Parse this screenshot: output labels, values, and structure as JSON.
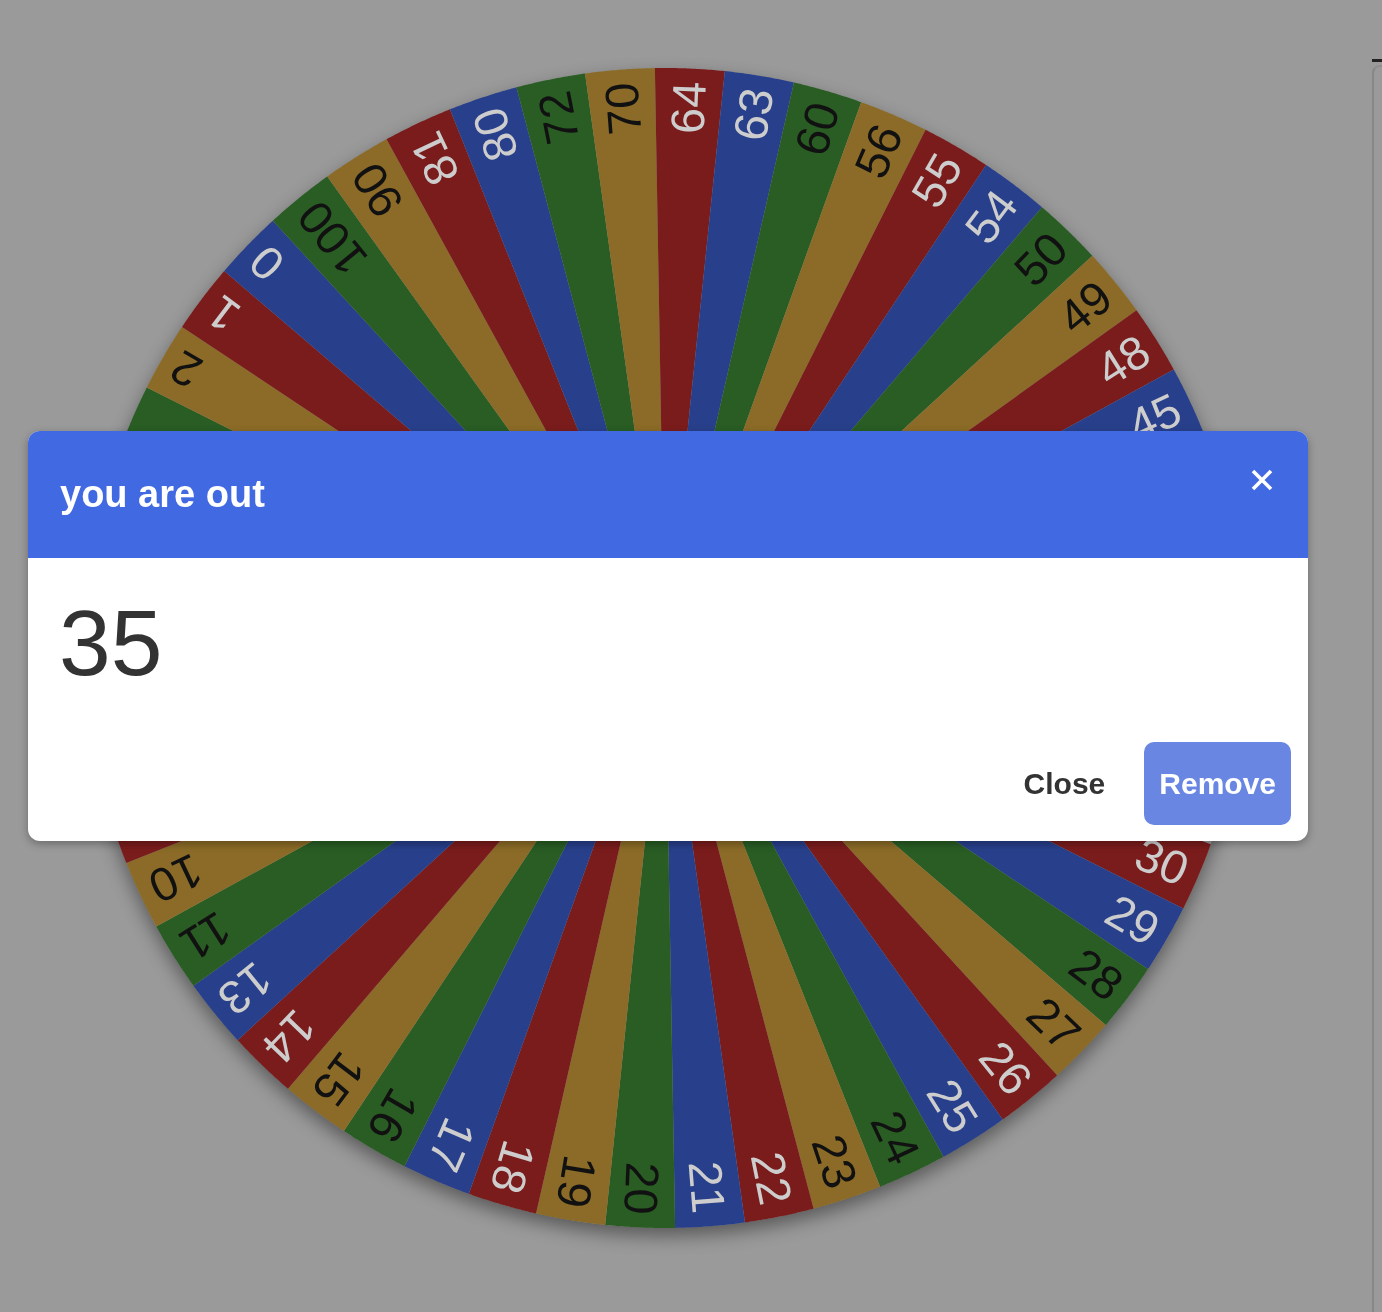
{
  "wheel": {
    "upper_arc": [
      {
        "color": "#295d24"
      },
      {
        "label": "2",
        "color": "#8b6b27"
      },
      {
        "label": "1",
        "color": "#7b1c1c"
      },
      {
        "label": "0",
        "color": "#283f8b"
      },
      {
        "label": "100",
        "color": "#295d24"
      },
      {
        "label": "90",
        "color": "#8b6b27"
      },
      {
        "label": "81",
        "color": "#7b1c1c"
      },
      {
        "label": "80",
        "color": "#283f8b"
      },
      {
        "label": "72",
        "color": "#295d24"
      },
      {
        "label": "70",
        "color": "#8b6b27"
      },
      {
        "label": "64",
        "color": "#7b1c1c"
      },
      {
        "label": "63",
        "color": "#283f8b"
      },
      {
        "label": "60",
        "color": "#295d24"
      },
      {
        "label": "56",
        "color": "#8b6b27"
      },
      {
        "label": "55",
        "color": "#7b1c1c"
      },
      {
        "label": "54",
        "color": "#283f8b"
      },
      {
        "label": "50",
        "color": "#295d24"
      },
      {
        "label": "49",
        "color": "#8b6b27"
      },
      {
        "label": "48",
        "color": "#7b1c1c"
      },
      {
        "label": "45",
        "color": "#283f8b"
      }
    ],
    "lower_arc": [
      {
        "label": "30",
        "color": "#7b1c1c"
      },
      {
        "label": "29",
        "color": "#283f8b"
      },
      {
        "label": "28",
        "color": "#295d24"
      },
      {
        "label": "27",
        "color": "#8b6b27"
      },
      {
        "label": "26",
        "color": "#7b1c1c"
      },
      {
        "label": "25",
        "color": "#283f8b"
      },
      {
        "label": "24",
        "color": "#295d24"
      },
      {
        "label": "23",
        "color": "#8b6b27"
      },
      {
        "label": "22",
        "color": "#7b1c1c"
      },
      {
        "label": "21",
        "color": "#283f8b"
      },
      {
        "label": "20",
        "color": "#295d24"
      },
      {
        "label": "19",
        "color": "#8b6b27"
      },
      {
        "label": "18",
        "color": "#7b1c1c"
      },
      {
        "label": "17",
        "color": "#283f8b"
      },
      {
        "label": "16",
        "color": "#295d24"
      },
      {
        "label": "15",
        "color": "#8b6b27"
      },
      {
        "label": "14",
        "color": "#7b1c1c"
      },
      {
        "label": "13",
        "color": "#283f8b"
      },
      {
        "label": "11",
        "color": "#295d24"
      },
      {
        "label": "10",
        "color": "#8b6b27"
      },
      {
        "color": "#7b1c1c"
      }
    ]
  },
  "dialog": {
    "title": "you are out",
    "message": "35",
    "buttons": [
      {
        "label": "Close",
        "kind": "text"
      },
      {
        "label": "Remove",
        "kind": "primary"
      }
    ]
  }
}
